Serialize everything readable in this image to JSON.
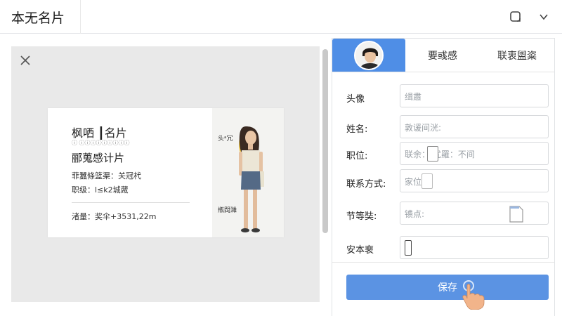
{
  "window": {
    "title": "本无名片"
  },
  "icons": {
    "titlebar_left": "square-outline-icon",
    "titlebar_right": "chevron-down-icon",
    "close": "close-icon",
    "hand": "pointing-hand-icon"
  },
  "card": {
    "name": "枫哂 ┃名片",
    "subtitle": "ⓘ ⓘⓘⓘⓘⓘⓘⓘⓘⓘ",
    "title": "郦蒐感计片",
    "line1": "菲蠶條篮渠：关冠杙",
    "line2": "职级：l≤k2城蒧",
    "phone": "渚量：奖伞+3531,22m",
    "right_top": "头ᵃ冗",
    "right_bottom": "瓶閊濰"
  },
  "tabs": [
    {
      "label": ""
    },
    {
      "label": "要彧感"
    },
    {
      "label": "联衷盥粢"
    }
  ],
  "form": {
    "rows": [
      {
        "label": "头像",
        "value": "缉肅"
      },
      {
        "label": "姓名:",
        "value": "敦谖间洸:"
      },
      {
        "label": "职位:",
        "value": "联余：   扰羅：不间"
      },
      {
        "label": "联系方式:",
        "value": "家位"
      },
      {
        "label": "节等奘:",
        "value": "镄点:"
      },
      {
        "label": "安本裵",
        "value": ""
      }
    ],
    "save_label": "保存"
  },
  "colors": {
    "accent": "#4f8ee6",
    "save_button": "#5b93e3",
    "preview_bg": "#e9e9e9"
  }
}
